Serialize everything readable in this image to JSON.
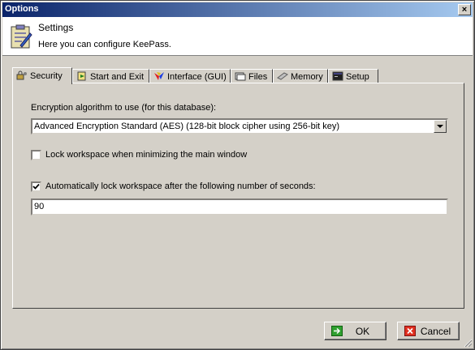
{
  "window": {
    "title": "Options",
    "close_label": "×"
  },
  "header": {
    "title": "Settings",
    "subtitle": "Here you can configure KeePass."
  },
  "tabs": [
    {
      "label": "Security",
      "icon": "security-icon",
      "active": true
    },
    {
      "label": "Start and Exit",
      "icon": "start-exit-icon"
    },
    {
      "label": "Interface (GUI)",
      "icon": "interface-icon"
    },
    {
      "label": "Files",
      "icon": "files-icon"
    },
    {
      "label": "Memory",
      "icon": "memory-icon"
    },
    {
      "label": "Setup",
      "icon": "setup-icon"
    }
  ],
  "security": {
    "encryption_label": "Encryption algorithm to use (for this database):",
    "encryption_value": "Advanced Encryption Standard (AES) (128-bit block cipher using 256-bit key)",
    "lock_minimize_label": "Lock workspace when minimizing the main window",
    "lock_minimize_checked": false,
    "auto_lock_label": "Automatically lock workspace after the following number of seconds:",
    "auto_lock_checked": true,
    "auto_lock_seconds": "90"
  },
  "buttons": {
    "ok_label": "OK",
    "cancel_label": "Cancel"
  },
  "colors": {
    "face": "#d4d0c8",
    "title_start": "#0a246a",
    "title_end": "#a6caf0"
  }
}
